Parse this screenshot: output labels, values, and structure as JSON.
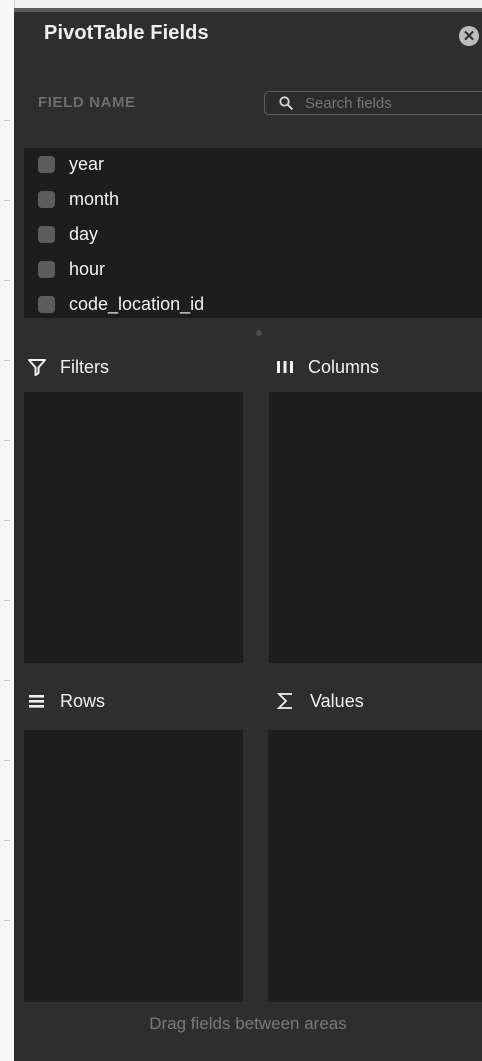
{
  "panel": {
    "title": "PivotTable Fields",
    "close_icon": "close-circle-icon"
  },
  "field_section": {
    "header": "FIELD NAME",
    "search_placeholder": "Search fields",
    "search_value": "",
    "fields": [
      {
        "label": "year",
        "checked": false
      },
      {
        "label": "month",
        "checked": false
      },
      {
        "label": "day",
        "checked": false
      },
      {
        "label": "hour",
        "checked": false
      },
      {
        "label": "code_location_id",
        "checked": false
      }
    ]
  },
  "areas": {
    "filters": {
      "label": "Filters",
      "icon": "filter-funnel-icon"
    },
    "columns": {
      "label": "Columns",
      "icon": "columns-bars-icon"
    },
    "rows": {
      "label": "Rows",
      "icon": "rows-lines-icon"
    },
    "values": {
      "label": "Values",
      "icon": "sigma-icon"
    }
  },
  "footer": {
    "hint": "Drag fields between areas"
  },
  "colors": {
    "panel_bg": "#2e2e2e",
    "well_bg": "#1d1d1e",
    "text": "#f0f0f0",
    "muted_text": "#7a7a7a"
  }
}
